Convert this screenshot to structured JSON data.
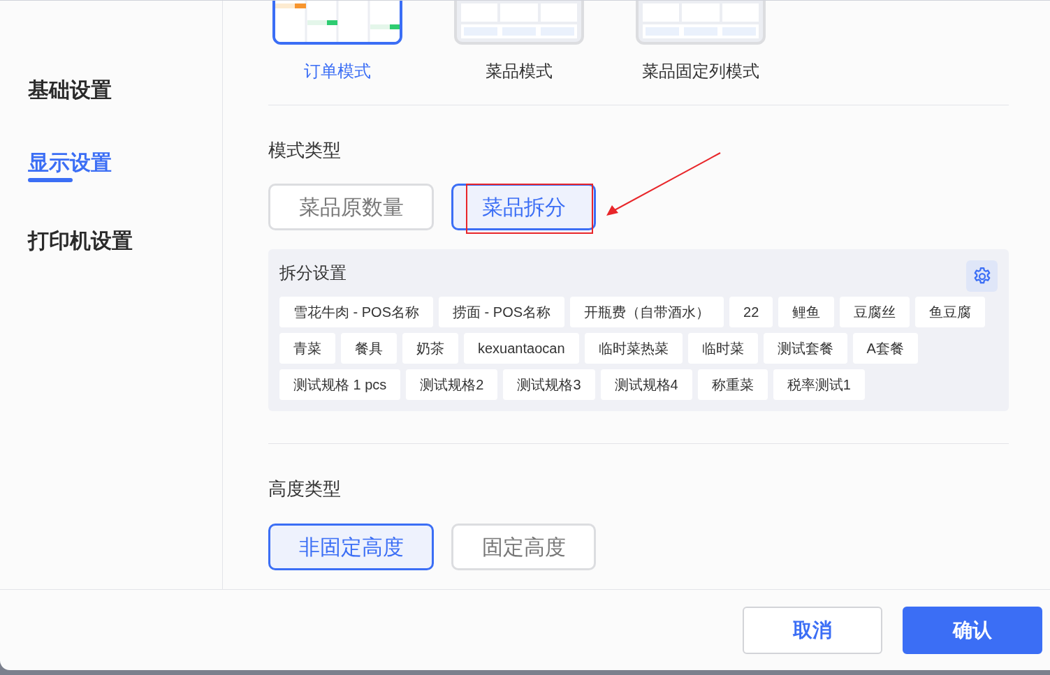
{
  "sidebar": {
    "items": [
      {
        "label": "基础设置",
        "selected": false
      },
      {
        "label": "显示设置",
        "selected": true
      },
      {
        "label": "打印机设置",
        "selected": false
      }
    ]
  },
  "display_modes": [
    {
      "label": "订单模式",
      "selected": true,
      "kind": "order"
    },
    {
      "label": "菜品模式",
      "selected": false,
      "kind": "dish"
    },
    {
      "label": "菜品固定列模式",
      "selected": false,
      "kind": "dish"
    }
  ],
  "mode_type": {
    "title": "模式类型",
    "options": [
      {
        "label": "菜品原数量",
        "selected": false,
        "highlighted": false
      },
      {
        "label": "菜品拆分",
        "selected": true,
        "highlighted": true
      }
    ]
  },
  "split_settings": {
    "title": "拆分设置",
    "items": [
      "雪花牛肉 - POS名称",
      "捞面 - POS名称",
      "开瓶费（自带酒水）",
      "22",
      "鲤鱼",
      "豆腐丝",
      "鱼豆腐",
      "青菜",
      "餐具",
      "奶茶",
      "kexuantaocan",
      "临时菜热菜",
      "临时菜",
      "测试套餐",
      "A套餐",
      "测试规格 1 pcs",
      "测试规格2",
      "测试规格3",
      "测试规格4",
      "称重菜",
      "税率测试1"
    ]
  },
  "height_type": {
    "title": "高度类型",
    "options": [
      {
        "label": "非固定高度",
        "selected": true
      },
      {
        "label": "固定高度",
        "selected": false
      }
    ]
  },
  "buttons": [
    {
      "label": "取消",
      "kind": "secondary"
    },
    {
      "label": "确认",
      "kind": "primary"
    }
  ]
}
